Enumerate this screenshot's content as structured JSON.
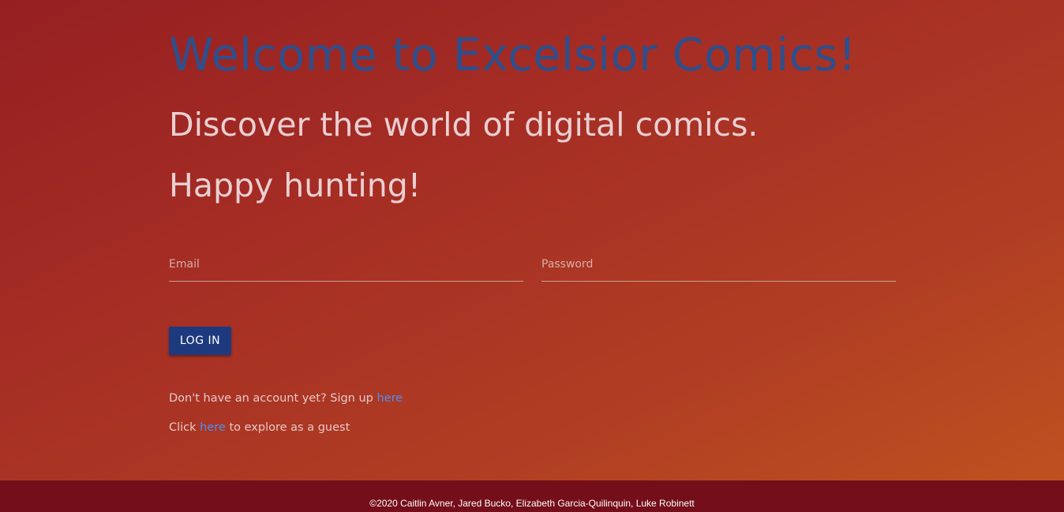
{
  "header": {
    "title": "Welcome to Excelsior Comics!",
    "tagline_1": "Discover the world of digital comics.",
    "tagline_2": "Happy hunting!"
  },
  "login_form": {
    "email_placeholder": "Email",
    "email_value": "",
    "password_placeholder": "Password",
    "password_value": "",
    "login_label": "LOG IN"
  },
  "signup": {
    "prefix": "Don't have an account yet? Sign up ",
    "link_label": "here"
  },
  "guest": {
    "prefix": "Click ",
    "link_label": "here",
    "suffix": " to explore as a guest"
  },
  "footer": {
    "text": "©2020 Caitlin Avner, Jared Bucko, Elizabeth Garcia-Quilinquin, Luke Robinett"
  },
  "colors": {
    "title": "#2e4f8c",
    "button": "#1e3a7f",
    "link": "#4d8ff0",
    "footer_bg": "#740e1a",
    "background_start": "#961f22",
    "background_end": "#c0531f"
  }
}
